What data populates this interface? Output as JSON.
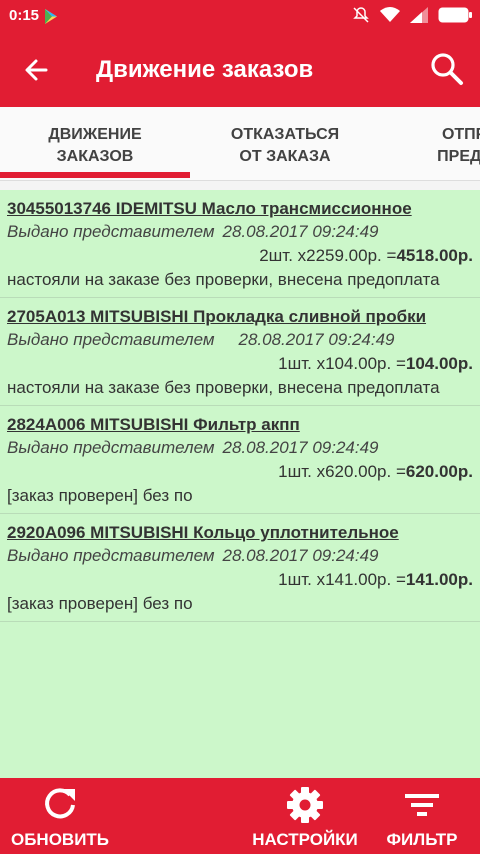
{
  "status_bar": {
    "time": "0:15"
  },
  "app_bar": {
    "title": "Движение заказов"
  },
  "tabs": [
    {
      "label": "ДВИЖЕНИЕ\nЗАКАЗОВ"
    },
    {
      "label": "ОТКАЗАТЬСЯ\nОТ ЗАКАЗА"
    },
    {
      "label": "ОТПРАВ\nПРЕДСТА"
    }
  ],
  "orders": [
    {
      "title": "30455013746 IDEMITSU Масло трансмиссионное ",
      "status": "Выдано представителем",
      "date": "28.08.2017 09:24:49",
      "qty": "2шт. x2259.00р. =",
      "total": "4518.00р.",
      "comment": "настояли на заказе без проверки, внесена предоплата"
    },
    {
      "title": "2705A013 MITSUBISHI Прокладка сливной пробки ",
      "status": "Выдано представителем",
      "date": "28.08.2017 09:24:49",
      "qty": "1шт. x104.00р. =",
      "total": "104.00р.",
      "comment": "настояли на заказе без проверки, внесена предоплата"
    },
    {
      "title": "2824A006 MITSUBISHI Фильтр акпп ",
      "status": "Выдано представителем",
      "date": "28.08.2017 09:24:49",
      "qty": "1шт. x620.00р. =",
      "total": "620.00р.",
      "comment": "[заказ проверен] без по"
    },
    {
      "title": "2920A096 MITSUBISHI Кольцо уплотнительное ",
      "status": "Выдано представителем",
      "date": "28.08.2017 09:24:49",
      "qty": "1шт. x141.00р. =",
      "total": "141.00р.",
      "comment": "[заказ проверен] без по"
    }
  ],
  "bottom_bar": {
    "refresh_label": "ОБНОВИТЬ",
    "settings_label": "НАСТРОЙКИ",
    "filter_label": "ФИЛЬТР"
  },
  "colors": {
    "primary": "#e11d33",
    "list_bg": "#ccf7ca"
  }
}
